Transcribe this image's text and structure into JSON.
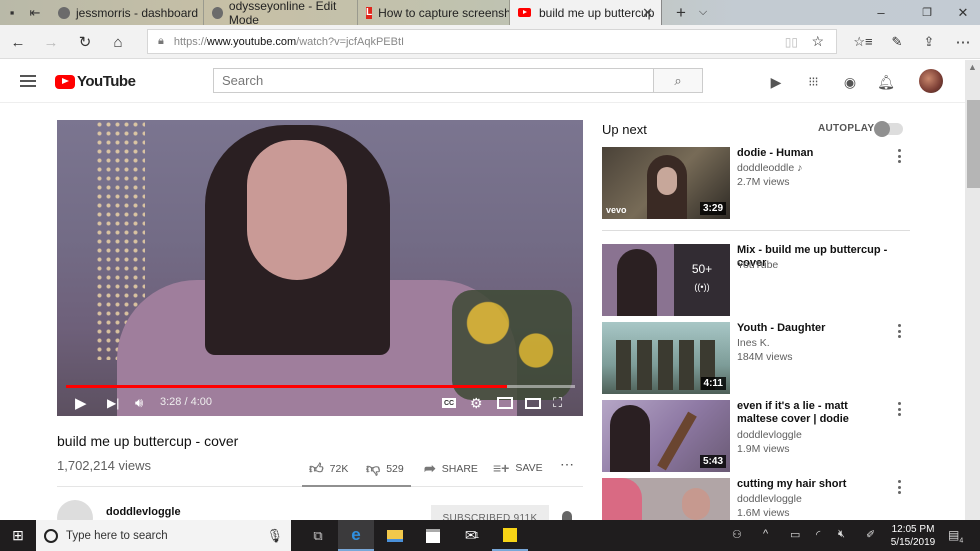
{
  "browser": {
    "tabs": [
      {
        "label": "jessmorris - dashboard",
        "icon": "site-icon"
      },
      {
        "label": "odysseyonline - Edit Mode",
        "icon": "site-icon"
      },
      {
        "label": "How to capture screenshot:",
        "icon": "lifewire-icon",
        "icon_text": "L"
      },
      {
        "label": "build me up buttercup",
        "icon": "youtube-icon",
        "active": true
      }
    ],
    "url_scheme": "https://",
    "url_host": "www.youtube.com",
    "url_path": "/watch?v=jcfAqkPEBtI"
  },
  "youtube": {
    "logo_text": "YouTube",
    "search_placeholder": "Search",
    "brand_color": "#ff0000"
  },
  "video": {
    "title": "build me up buttercup - cover",
    "views": "1,702,214 views",
    "time_display": "3:28 / 4:00",
    "progress_fraction": 0.867,
    "likes": "72K",
    "dislikes": "529",
    "share_label": "SHARE",
    "save_label": "SAVE",
    "like_ratio": 0.993,
    "channel": "doddlevloggle",
    "subscribe_label": "SUBSCRIBED  911K"
  },
  "sidebar": {
    "up_next_label": "Up next",
    "autoplay_label": "AUTOPLAY",
    "autoplay_on": false,
    "items": [
      {
        "title": "dodie - Human",
        "channel": "doddleoddle ♪",
        "views": "2.7M views",
        "duration": "3:29",
        "badge": "vevo"
      },
      {
        "title": "Mix - build me up buttercup - cover",
        "channel": "YouTube",
        "views": "",
        "playlist_count": "50+",
        "playlist_icon": "((•))"
      },
      {
        "title": "Youth - Daughter",
        "channel": "Ines K.",
        "views": "184M views",
        "duration": "4:11"
      },
      {
        "title": "even if it's a lie - matt maltese cover | dodie",
        "channel": "doddlevloggle",
        "views": "1.9M views",
        "duration": "5:43"
      },
      {
        "title": "cutting my hair short",
        "channel": "doddlevloggle",
        "views": "1.6M views",
        "duration": ""
      }
    ]
  },
  "taskbar": {
    "search_placeholder": "Type here to search",
    "time": "12:05 PM",
    "date": "5/15/2019",
    "notification_count": "4",
    "mail_badge": "1"
  }
}
